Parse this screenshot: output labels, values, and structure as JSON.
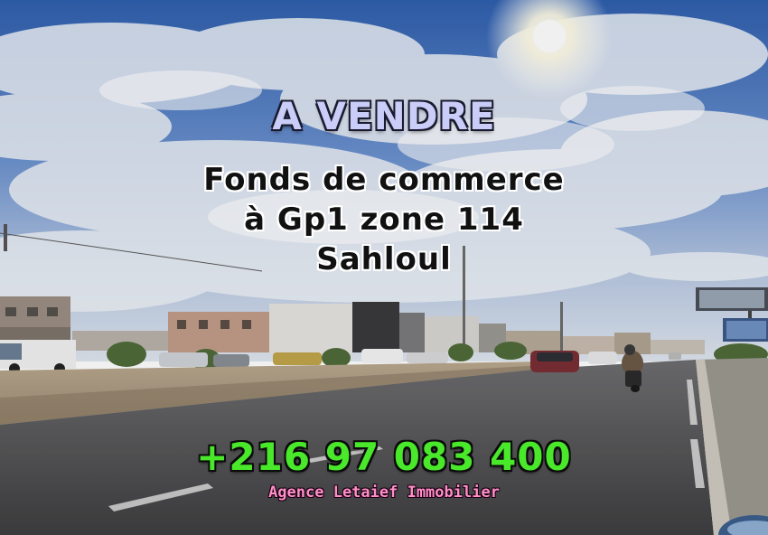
{
  "headline": "A VENDRE",
  "description_lines": [
    "Fonds de commerce",
    "à Gp1 zone 114",
    "Sahloul"
  ],
  "phone": "+216 97 083 400",
  "agency": "Agence Letaief Immobilier",
  "colors": {
    "headline": "#c9cdf7",
    "phone": "#49e82a",
    "agency": "#ff8fc9",
    "sky": "#3f6fb8"
  }
}
